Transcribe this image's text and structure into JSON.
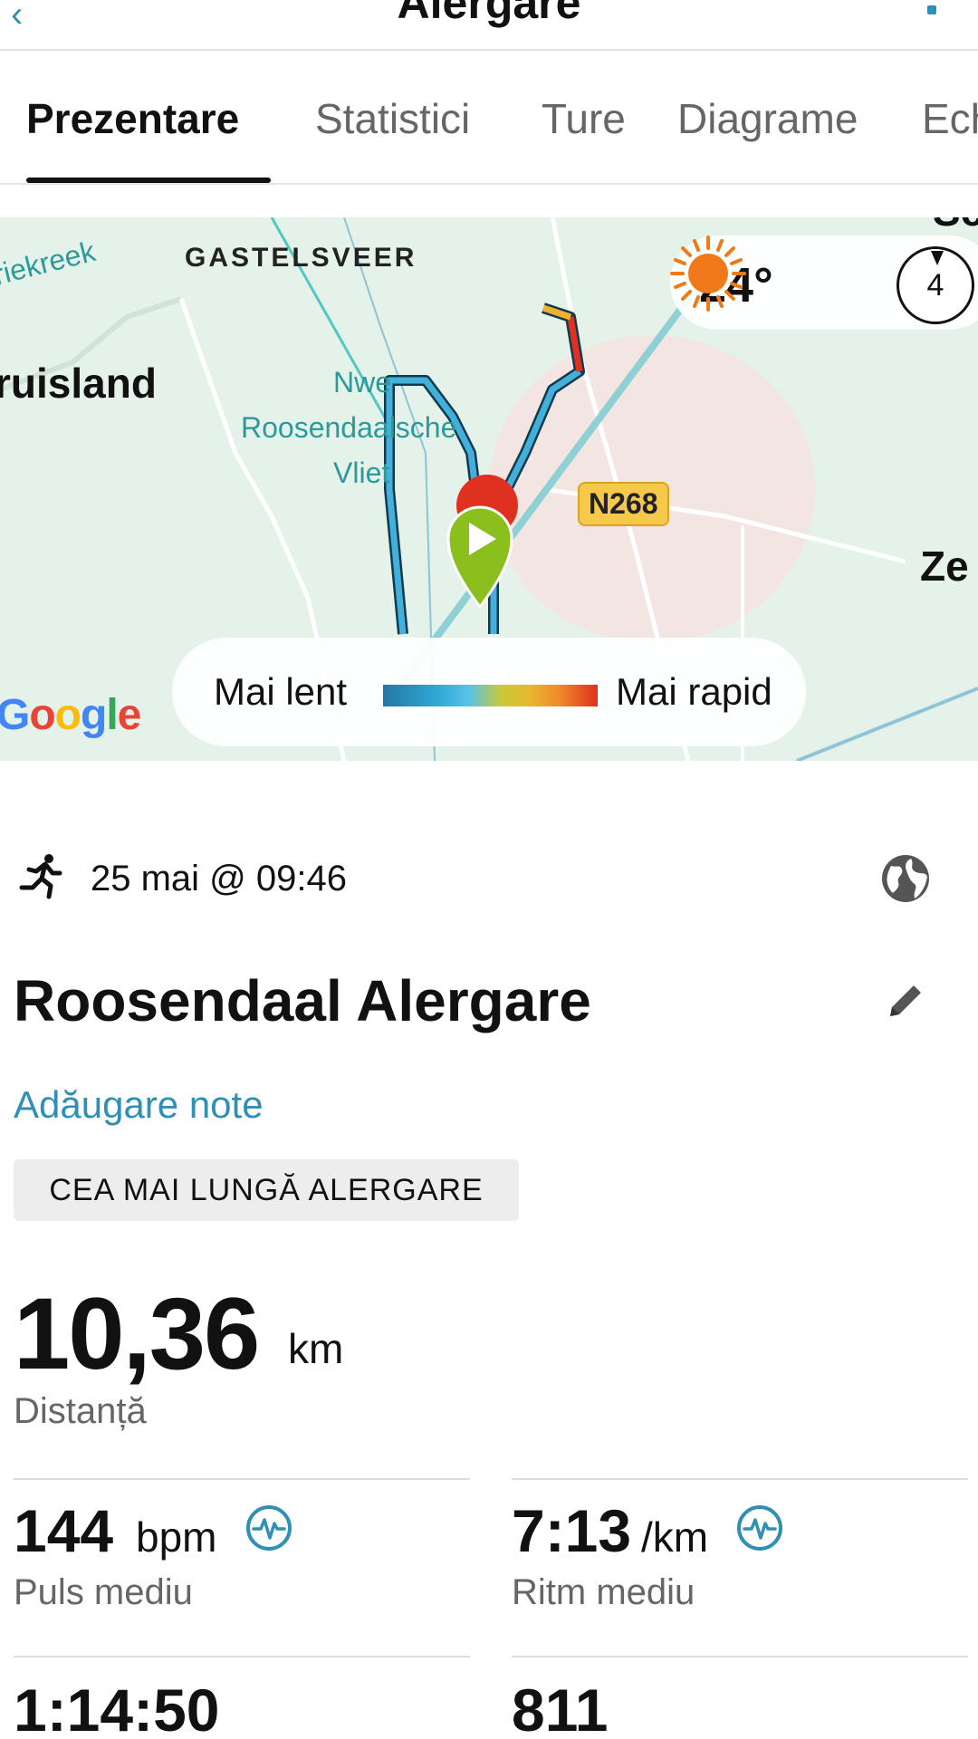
{
  "header": {
    "back_glyph": "‹",
    "title": "Alergare"
  },
  "tabs": [
    {
      "label": "Prezentare",
      "active": true
    },
    {
      "label": "Statistici",
      "active": false
    },
    {
      "label": "Ture",
      "active": false
    },
    {
      "label": "Diagrame",
      "active": false
    },
    {
      "label": "Ech",
      "active": false
    }
  ],
  "map": {
    "labels": {
      "water1": "riekreek",
      "place1": "GASTELSVEER",
      "town1": "ruisland",
      "water2_line1": "Nwe",
      "water2_line2": "Roosendaalsche",
      "water2_line3": "Vliet",
      "town2": "Ze",
      "road": "N268",
      "top_partial": "Sc"
    },
    "weather": {
      "temperature": "24°",
      "wind_speed": "4",
      "icon": "sun-icon"
    },
    "legend": {
      "slow": "Mai lent",
      "fast": "Mai rapid"
    },
    "attribution": "Google",
    "colors": {
      "route": "#43b0dc",
      "slow": "#2577a3",
      "fast": "#e0301f",
      "start_marker": "#8bbf1e"
    }
  },
  "activity": {
    "type_icon": "running-icon",
    "date": "25 mai @ 09:46",
    "title": "Roosendaal Alergare",
    "add_notes": "Adăugare note",
    "badge": "CEA MAI LUNGĂ ALERGARE"
  },
  "distance": {
    "value": "10,36",
    "unit": "km",
    "label": "Distanță"
  },
  "stats": [
    {
      "value": "144",
      "unit": "bpm",
      "label": "Puls mediu",
      "has_icon": true
    },
    {
      "value": "7:13",
      "unit": "/km",
      "label": "Ritm mediu",
      "has_icon": true
    },
    {
      "value": "1:14:50"
    },
    {
      "value": "811"
    }
  ],
  "accent_color": "#2f8fb4"
}
